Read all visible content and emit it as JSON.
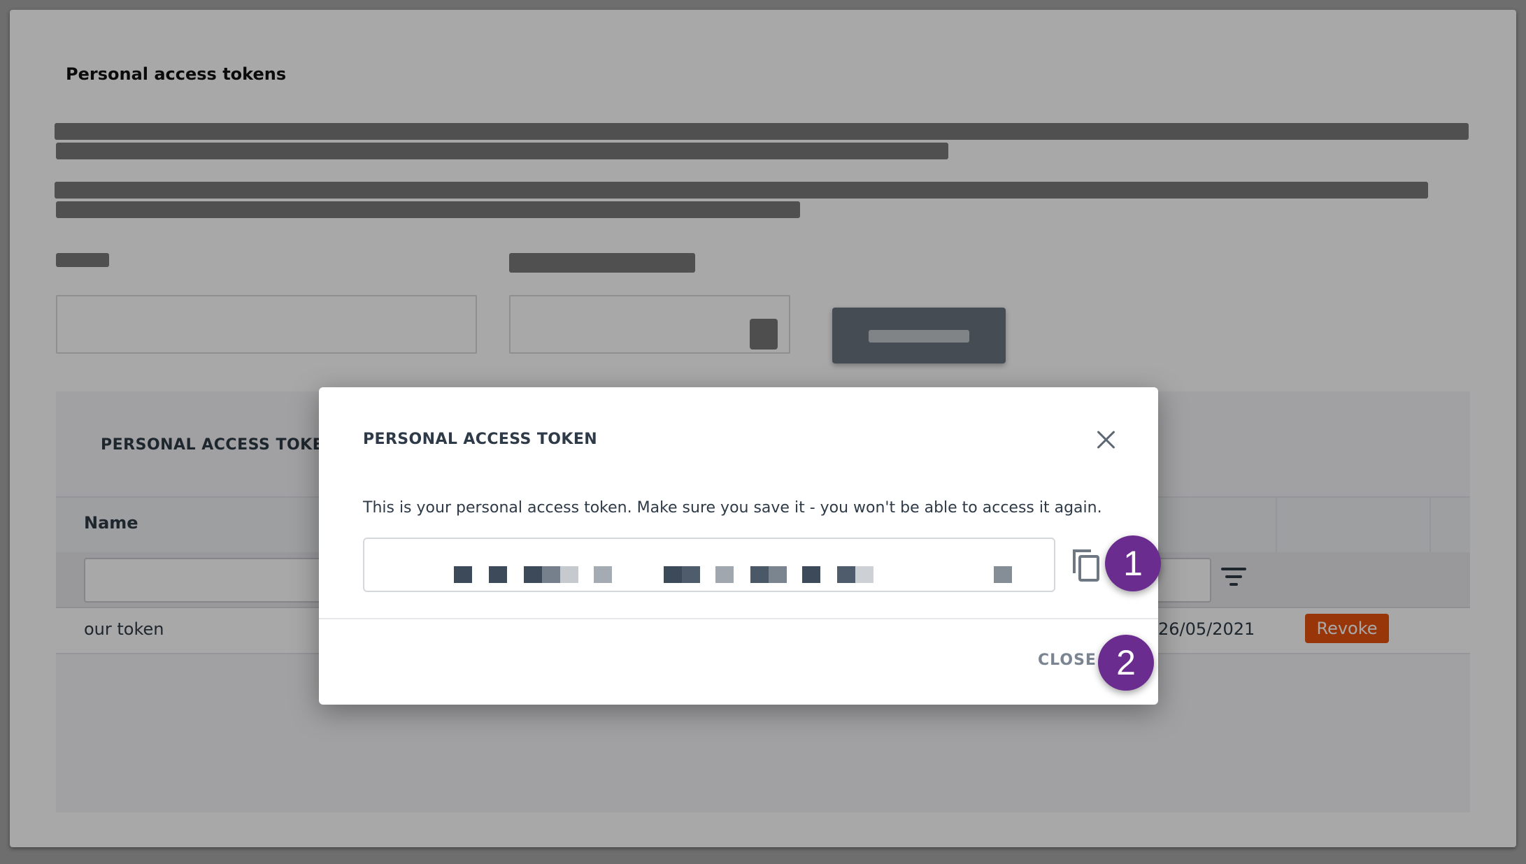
{
  "page": {
    "title": "Personal access tokens"
  },
  "table": {
    "section_title": "PERSONAL ACCESS TOKEN",
    "columns": {
      "name": "Name"
    },
    "rows": [
      {
        "name": "our token",
        "date": "26/05/2021",
        "action": "Revoke"
      }
    ]
  },
  "modal": {
    "title": "PERSONAL ACCESS TOKEN",
    "message": "This is your personal access token. Make sure you save it - you won't be able to access it again.",
    "close_label": "CLOSE"
  },
  "annotations": {
    "step1": "1",
    "step2": "2"
  },
  "colors": {
    "accent_purple": "#6a2c8f",
    "revoke_orange": "#e8520f"
  }
}
